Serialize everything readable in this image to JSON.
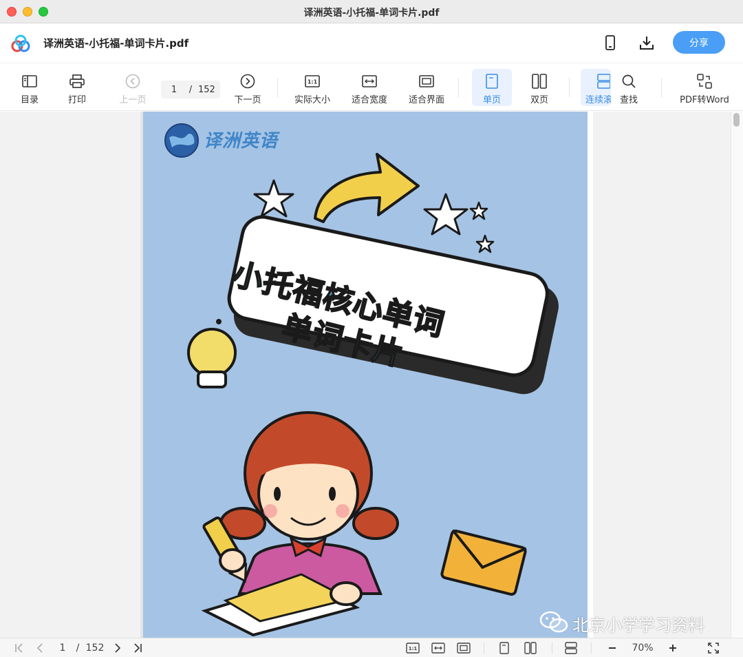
{
  "window": {
    "title": "译洲英语-小托福-单词卡片.pdf"
  },
  "header": {
    "doc_title": "译洲英语-小托福-单词卡片.pdf",
    "share_label": "分享",
    "icons": [
      "cloud-logo-icon",
      "phone-icon",
      "download-icon"
    ]
  },
  "toolbar": {
    "items": [
      {
        "label": "目录",
        "icon": "sidebar-icon",
        "enabled": true,
        "active": false
      },
      {
        "label": "打印",
        "icon": "printer-icon",
        "enabled": true,
        "active": false
      },
      {
        "label": "上一页",
        "icon": "prev-page-icon",
        "enabled": false,
        "active": false
      },
      {
        "label": "下一页",
        "icon": "next-page-icon",
        "enabled": true,
        "active": false
      },
      {
        "label": "实际大小",
        "icon": "actual-size-icon",
        "enabled": true,
        "active": false
      },
      {
        "label": "适合宽度",
        "icon": "fit-width-icon",
        "enabled": true,
        "active": false
      },
      {
        "label": "适合界面",
        "icon": "fit-page-icon",
        "enabled": true,
        "active": false
      },
      {
        "label": "单页",
        "icon": "single-page-icon",
        "enabled": true,
        "active": true
      },
      {
        "label": "双页",
        "icon": "two-page-icon",
        "enabled": true,
        "active": false
      },
      {
        "label": "连续滚",
        "icon": "continuous-scroll-icon",
        "enabled": true,
        "active": true
      },
      {
        "label": "查找",
        "icon": "search-icon",
        "enabled": true,
        "active": false
      },
      {
        "label": "PDF转Word",
        "icon": "convert-icon",
        "enabled": true,
        "active": false
      }
    ],
    "page_current": "1",
    "page_separator": "/",
    "page_total": "152"
  },
  "document": {
    "brand_text": "译洲英语",
    "title_line1": "小托福核心单词",
    "title_line2": "单词卡片",
    "watermark": "北京小学学习资料",
    "background_color": "#a5c3e4"
  },
  "bottombar": {
    "page_current": "1",
    "page_separator": "/",
    "page_total": "152",
    "zoom": "70%"
  },
  "colors": {
    "accent": "#4a9ef5",
    "active_bg": "#e8f1fd",
    "active_text": "#3a8ee6"
  }
}
